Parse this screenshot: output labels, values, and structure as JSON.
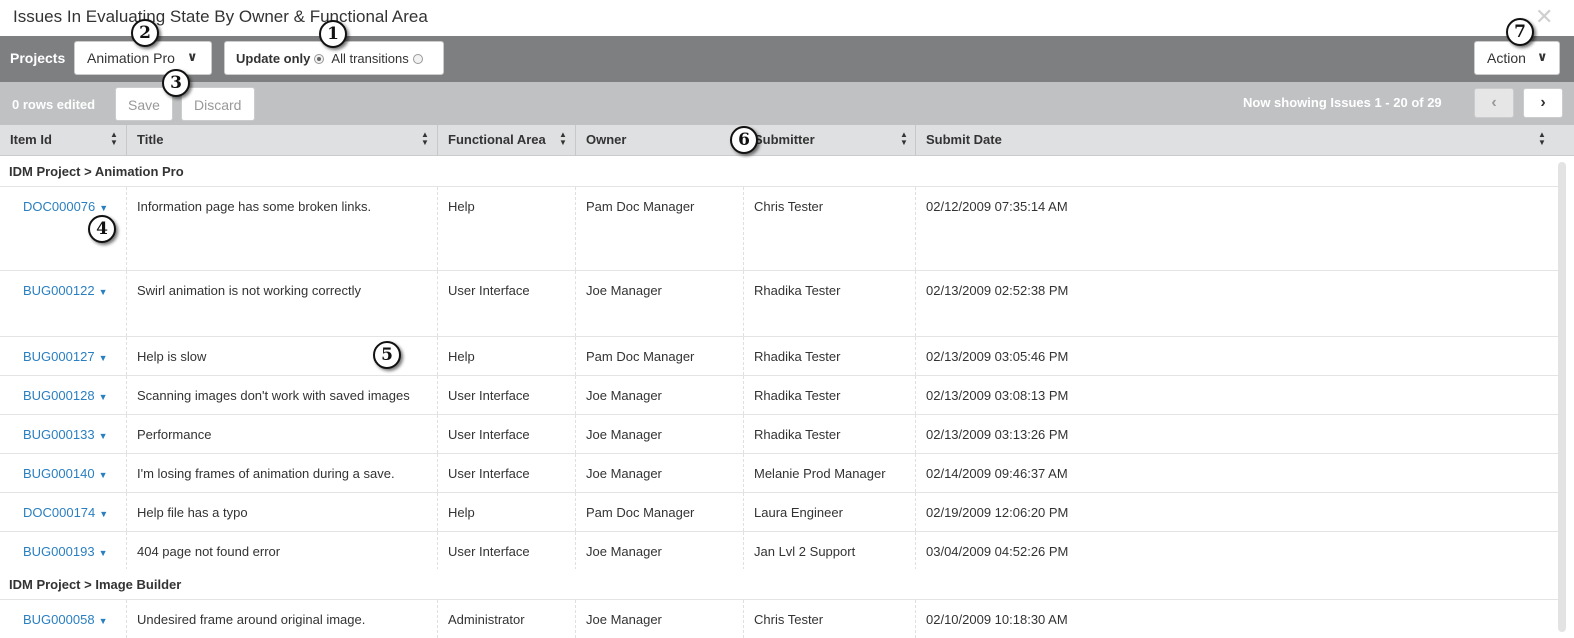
{
  "window": {
    "title": "Issues In Evaluating State By Owner & Functional Area",
    "close_glyph": "✕"
  },
  "toolbar": {
    "projects_label": "Projects",
    "project_value": "Animation Pro",
    "update_only_label": "Update only",
    "all_transitions_label": "All transitions",
    "selected_mode": "Update only",
    "action_label": "Action"
  },
  "edit_bar": {
    "rows_edited": "0 rows edited",
    "save_label": "Save",
    "discard_label": "Discard",
    "showing_text": "Now showing Issues 1 - 20 of 29",
    "prev_glyph": "‹",
    "next_glyph": "›"
  },
  "columns": [
    {
      "label": "Item Id"
    },
    {
      "label": "Title"
    },
    {
      "label": "Functional Area"
    },
    {
      "label": "Owner"
    },
    {
      "label": "Submitter"
    },
    {
      "label": "Submit Date"
    }
  ],
  "groups": [
    {
      "label": "IDM Project > Animation Pro",
      "rows": [
        {
          "id": "DOC000076",
          "title": "Information page has some broken links.",
          "area": "Help",
          "owner": "Pam Doc Manager",
          "submitter": "Chris Tester",
          "date": "02/12/2009 07:35:14 AM"
        },
        {
          "id": "BUG000122",
          "title": "Swirl animation is not working correctly",
          "area": "User Interface",
          "owner": "Joe Manager",
          "submitter": "Rhadika Tester",
          "date": "02/13/2009 02:52:38 PM"
        },
        {
          "id": "BUG000127",
          "title": "Help is slow",
          "area": "Help",
          "owner": "Pam Doc Manager",
          "submitter": "Rhadika Tester",
          "date": "02/13/2009 03:05:46 PM"
        },
        {
          "id": "BUG000128",
          "title": "Scanning images don't work with saved images",
          "area": "User Interface",
          "owner": "Joe Manager",
          "submitter": "Rhadika Tester",
          "date": "02/13/2009 03:08:13 PM"
        },
        {
          "id": "BUG000133",
          "title": "Performance",
          "area": "User Interface",
          "owner": "Joe Manager",
          "submitter": "Rhadika Tester",
          "date": "02/13/2009 03:13:26 PM"
        },
        {
          "id": "BUG000140",
          "title": "I'm losing frames of animation during a save.",
          "area": "User Interface",
          "owner": "Joe Manager",
          "submitter": "Melanie Prod Manager",
          "date": "02/14/2009 09:46:37 AM"
        },
        {
          "id": "DOC000174",
          "title": "Help file has a typo",
          "area": "Help",
          "owner": "Pam Doc Manager",
          "submitter": "Laura Engineer",
          "date": "02/19/2009 12:06:20 PM"
        },
        {
          "id": "BUG000193",
          "title": "404 page not found error",
          "area": "User Interface",
          "owner": "Joe Manager",
          "submitter": "Jan Lvl 2 Support",
          "date": "03/04/2009 04:52:26 PM"
        }
      ]
    },
    {
      "label": "IDM Project > Image Builder",
      "rows": [
        {
          "id": "BUG000058",
          "title": "Undesired frame around original image.",
          "area": "Administrator",
          "owner": "Joe Manager",
          "submitter": "Chris Tester",
          "date": "02/10/2009 10:18:30 AM"
        }
      ]
    }
  ],
  "callouts": [
    "1",
    "2",
    "3",
    "4",
    "5",
    "6",
    "7"
  ],
  "icons": {
    "row_menu": "caret-down-icon",
    "sort": "sort-icon",
    "dropdown": "chevron-down-icon"
  },
  "colors": {
    "toolbar": "#7d7f81",
    "edit_bar": "#bfc1c3",
    "header": "#dfe0e2",
    "link": "#2a7fc1"
  }
}
